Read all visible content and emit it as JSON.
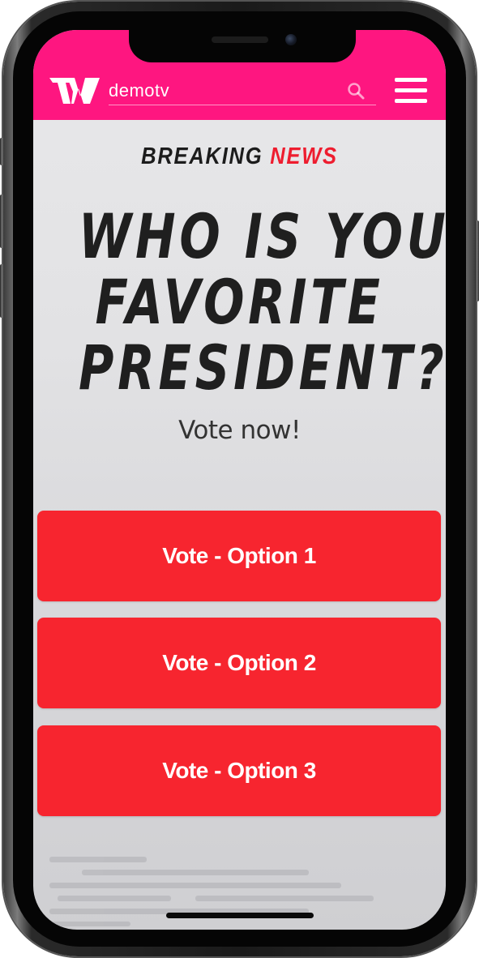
{
  "header": {
    "brand_text": "demotv",
    "brand_color": "#fe1680",
    "search_icon": "search-icon",
    "menu_icon": "hamburger-menu-icon"
  },
  "banner": {
    "kicker_prefix": "BREAKING",
    "kicker_accent": "NEWS",
    "kicker_accent_color": "#ee1d2f"
  },
  "poll": {
    "question_lines": [
      "WHO IS YOUR",
      "FAVORITE",
      "PRESIDENT?"
    ],
    "call_to_action": "Vote now!",
    "button_color": "#f7252f",
    "options": [
      {
        "label": "Vote - Option 1"
      },
      {
        "label": "Vote - Option 2"
      },
      {
        "label": "Vote - Option 3"
      }
    ]
  }
}
